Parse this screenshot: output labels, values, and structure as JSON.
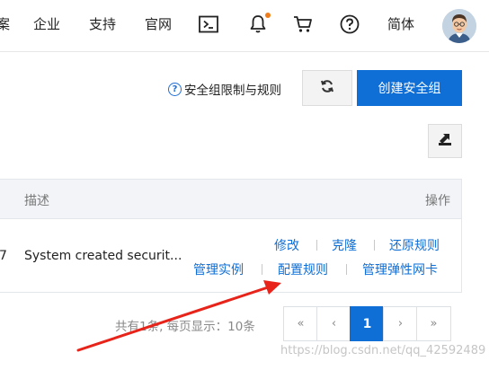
{
  "nav": {
    "cut_item": "案",
    "enterprise": "企业",
    "support": "支持",
    "official": "官网",
    "language": "简体",
    "icons": [
      "terminal-icon",
      "bell-icon",
      "cart-icon",
      "help-icon"
    ],
    "notification_dot_color": "#f07c1a"
  },
  "toolbar": {
    "help_link": "安全组限制与规则",
    "refresh_icon": "refresh-icon",
    "create_button": "创建安全组",
    "export_icon": "export-icon"
  },
  "table": {
    "headers": {
      "description": "描述",
      "actions": "操作"
    },
    "rows": [
      {
        "cut_value": "7",
        "description": "System created securit...",
        "actions_row1": [
          "修改",
          "克隆",
          "还原规则"
        ],
        "actions_row2": [
          "管理实例",
          "配置规则",
          "管理弹性网卡"
        ]
      }
    ]
  },
  "pagination": {
    "summary": "共有1条, 每页显示：10条",
    "first": "«",
    "prev": "‹",
    "current": "1",
    "next": "›",
    "last": "»"
  },
  "annotation": {
    "arrow_color": "#e8231a"
  },
  "watermark": "https://blog.csdn.net/qq_42592489",
  "colors": {
    "accent": "#0f6fd6",
    "header_bg": "#f2f4f7"
  }
}
